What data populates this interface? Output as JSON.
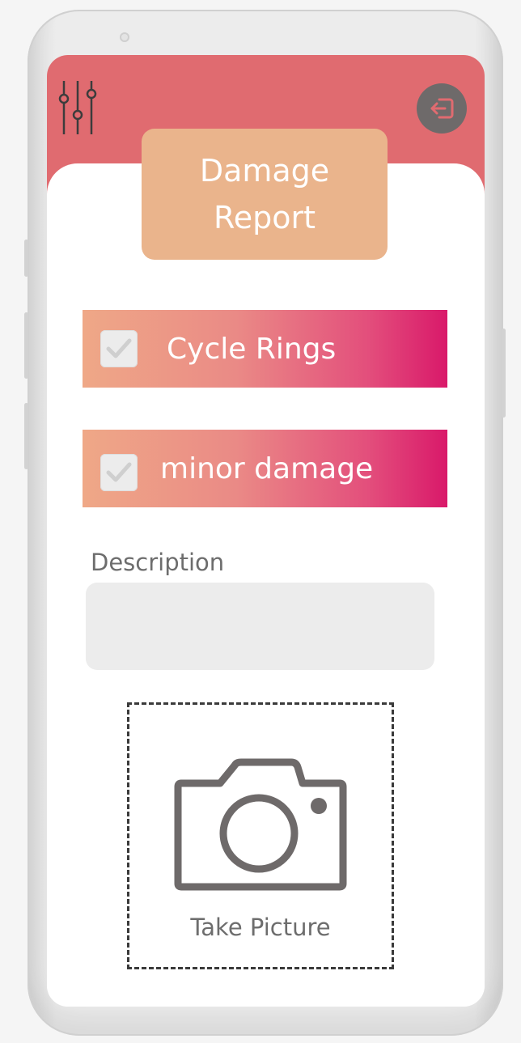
{
  "colors": {
    "header": "#e06b70",
    "title_card": "#eab48c",
    "option_gradient_start": "#efa887",
    "option_gradient_end": "#d9196a",
    "icon_gray": "#6e6a6a",
    "input_bg": "#ececec"
  },
  "header": {
    "filter_icon": "sliders-icon",
    "logout_icon": "logout-icon"
  },
  "title": {
    "line1": "Damage",
    "line2": "Report"
  },
  "options": [
    {
      "label": "Cycle Rings",
      "checked": true,
      "icon": "check-icon"
    },
    {
      "label": "minor damage",
      "checked": true,
      "icon": "check-icon"
    }
  ],
  "description": {
    "label": "Description",
    "value": "",
    "placeholder": ""
  },
  "picture": {
    "label": "Take Picture",
    "icon": "camera-icon"
  }
}
